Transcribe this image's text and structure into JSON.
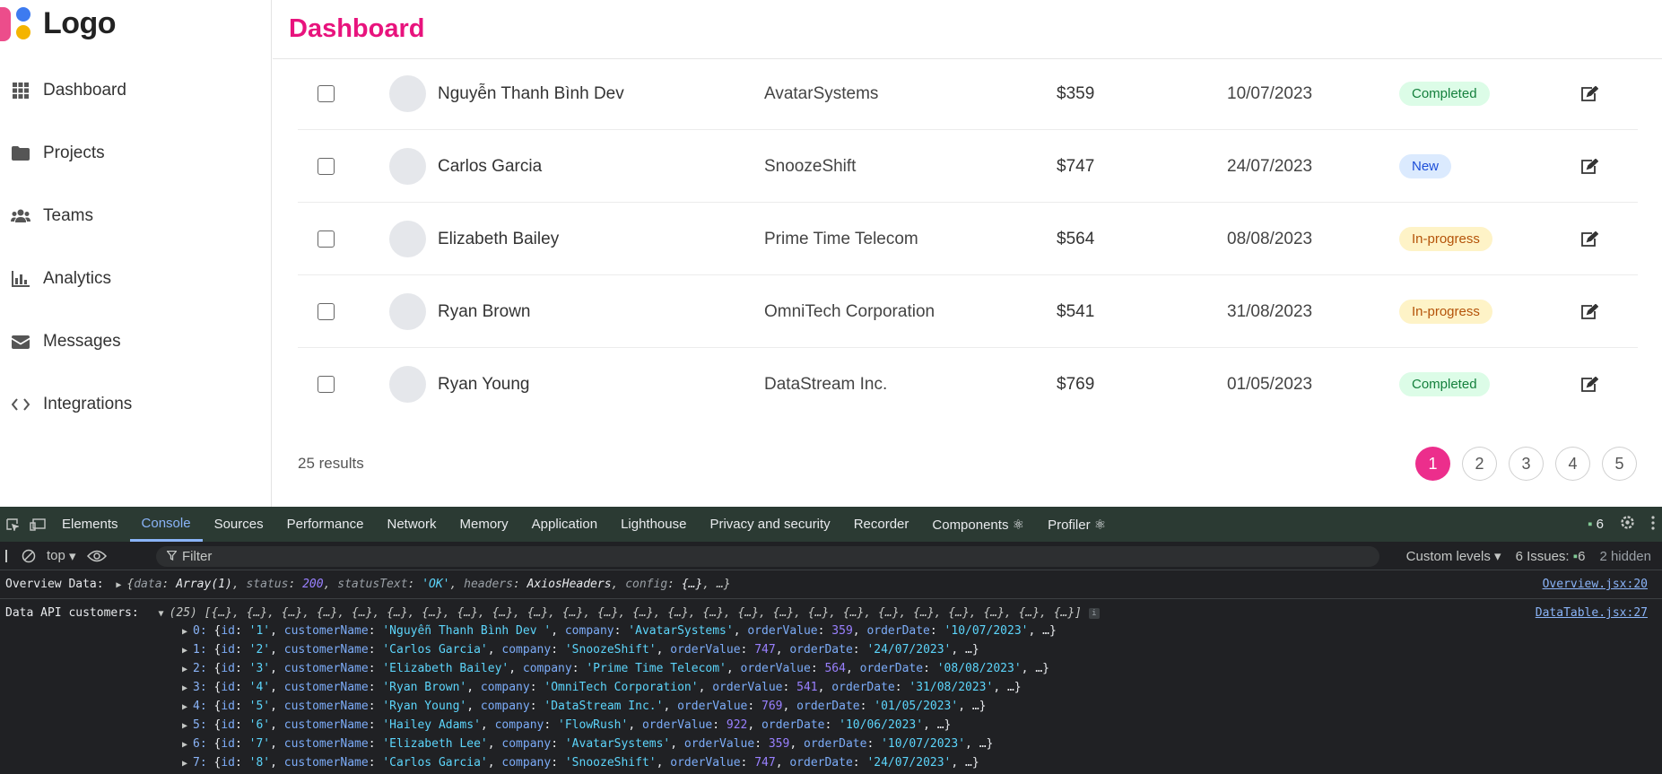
{
  "logo": {
    "text": "Logo"
  },
  "sidebar": {
    "items": [
      {
        "label": "Dashboard",
        "icon": "grid-icon"
      },
      {
        "label": "Projects",
        "icon": "folder-icon"
      },
      {
        "label": "Teams",
        "icon": "users-icon"
      },
      {
        "label": "Analytics",
        "icon": "bar-chart-icon"
      },
      {
        "label": "Messages",
        "icon": "envelope-icon"
      },
      {
        "label": "Integrations",
        "icon": "code-icon"
      }
    ]
  },
  "header": {
    "title": "Dashboard"
  },
  "table": {
    "rows": [
      {
        "name": "Nguyễn Thanh Bình Dev",
        "company": "AvatarSystems",
        "value": "$359",
        "date": "10/07/2023",
        "status": "Completed"
      },
      {
        "name": "Carlos Garcia",
        "company": "SnoozeShift",
        "value": "$747",
        "date": "24/07/2023",
        "status": "New"
      },
      {
        "name": "Elizabeth Bailey",
        "company": "Prime Time Telecom",
        "value": "$564",
        "date": "08/08/2023",
        "status": "In-progress"
      },
      {
        "name": "Ryan Brown",
        "company": "OmniTech Corporation",
        "value": "$541",
        "date": "31/08/2023",
        "status": "In-progress"
      },
      {
        "name": "Ryan Young",
        "company": "DataStream Inc.",
        "value": "$769",
        "date": "01/05/2023",
        "status": "Completed"
      }
    ],
    "results_text": "25 results"
  },
  "pagination": {
    "pages": [
      "1",
      "2",
      "3",
      "4",
      "5"
    ],
    "active": "1"
  },
  "colors": {
    "brand": "#e8137d",
    "active_page": "#ec2e8c"
  },
  "devtools": {
    "tabs": [
      "Elements",
      "Console",
      "Sources",
      "Performance",
      "Network",
      "Memory",
      "Application",
      "Lighthouse",
      "Privacy and security",
      "Recorder",
      "Components ⚛",
      "Profiler ⚛"
    ],
    "active_tab": "Console",
    "messages_count": "6",
    "toolbar": {
      "context": "top",
      "filter_placeholder": "Filter",
      "levels": "Custom levels",
      "issues_label": "6 Issues:",
      "issues_count": "6",
      "hidden": "2 hidden"
    },
    "logs": {
      "overview_label": "Overview Data:",
      "overview_source": "Overview.jsx:20",
      "customers_label": "Data API customers:",
      "customers_source": "DataTable.jsx:27",
      "customers_summary": "(25) [{…}, {…}, {…}, {…}, {…}, {…}, {…}, {…}, {…}, {…}, {…}, {…}, {…}, {…}, {…}, {…}, {…}, {…}, {…}, {…}, {…}, {…}, {…}, {…}, {…}]",
      "entries": [
        {
          "idx": "0",
          "id": "'1'",
          "customerName": "'Nguyễn Thanh Bình  Dev '",
          "company": "'AvatarSystems'",
          "orderValue": "359",
          "orderDate": "'10/07/2023'"
        },
        {
          "idx": "1",
          "id": "'2'",
          "customerName": "'Carlos Garcia'",
          "company": "'SnoozeShift'",
          "orderValue": "747",
          "orderDate": "'24/07/2023'"
        },
        {
          "idx": "2",
          "id": "'3'",
          "customerName": "'Elizabeth Bailey'",
          "company": "'Prime Time Telecom'",
          "orderValue": "564",
          "orderDate": "'08/08/2023'"
        },
        {
          "idx": "3",
          "id": "'4'",
          "customerName": "'Ryan Brown'",
          "company": "'OmniTech Corporation'",
          "orderValue": "541",
          "orderDate": "'31/08/2023'"
        },
        {
          "idx": "4",
          "id": "'5'",
          "customerName": "'Ryan Young'",
          "company": "'DataStream Inc.'",
          "orderValue": "769",
          "orderDate": "'01/05/2023'"
        },
        {
          "idx": "5",
          "id": "'6'",
          "customerName": "'Hailey Adams'",
          "company": "'FlowRush'",
          "orderValue": "922",
          "orderDate": "'10/06/2023'"
        },
        {
          "idx": "6",
          "id": "'7'",
          "customerName": "'Elizabeth Lee'",
          "company": "'AvatarSystems'",
          "orderValue": "359",
          "orderDate": "'10/07/2023'"
        },
        {
          "idx": "7",
          "id": "'8'",
          "customerName": "'Carlos Garcia'",
          "company": "'SnoozeShift'",
          "orderValue": "747",
          "orderDate": "'24/07/2023'"
        }
      ]
    }
  }
}
